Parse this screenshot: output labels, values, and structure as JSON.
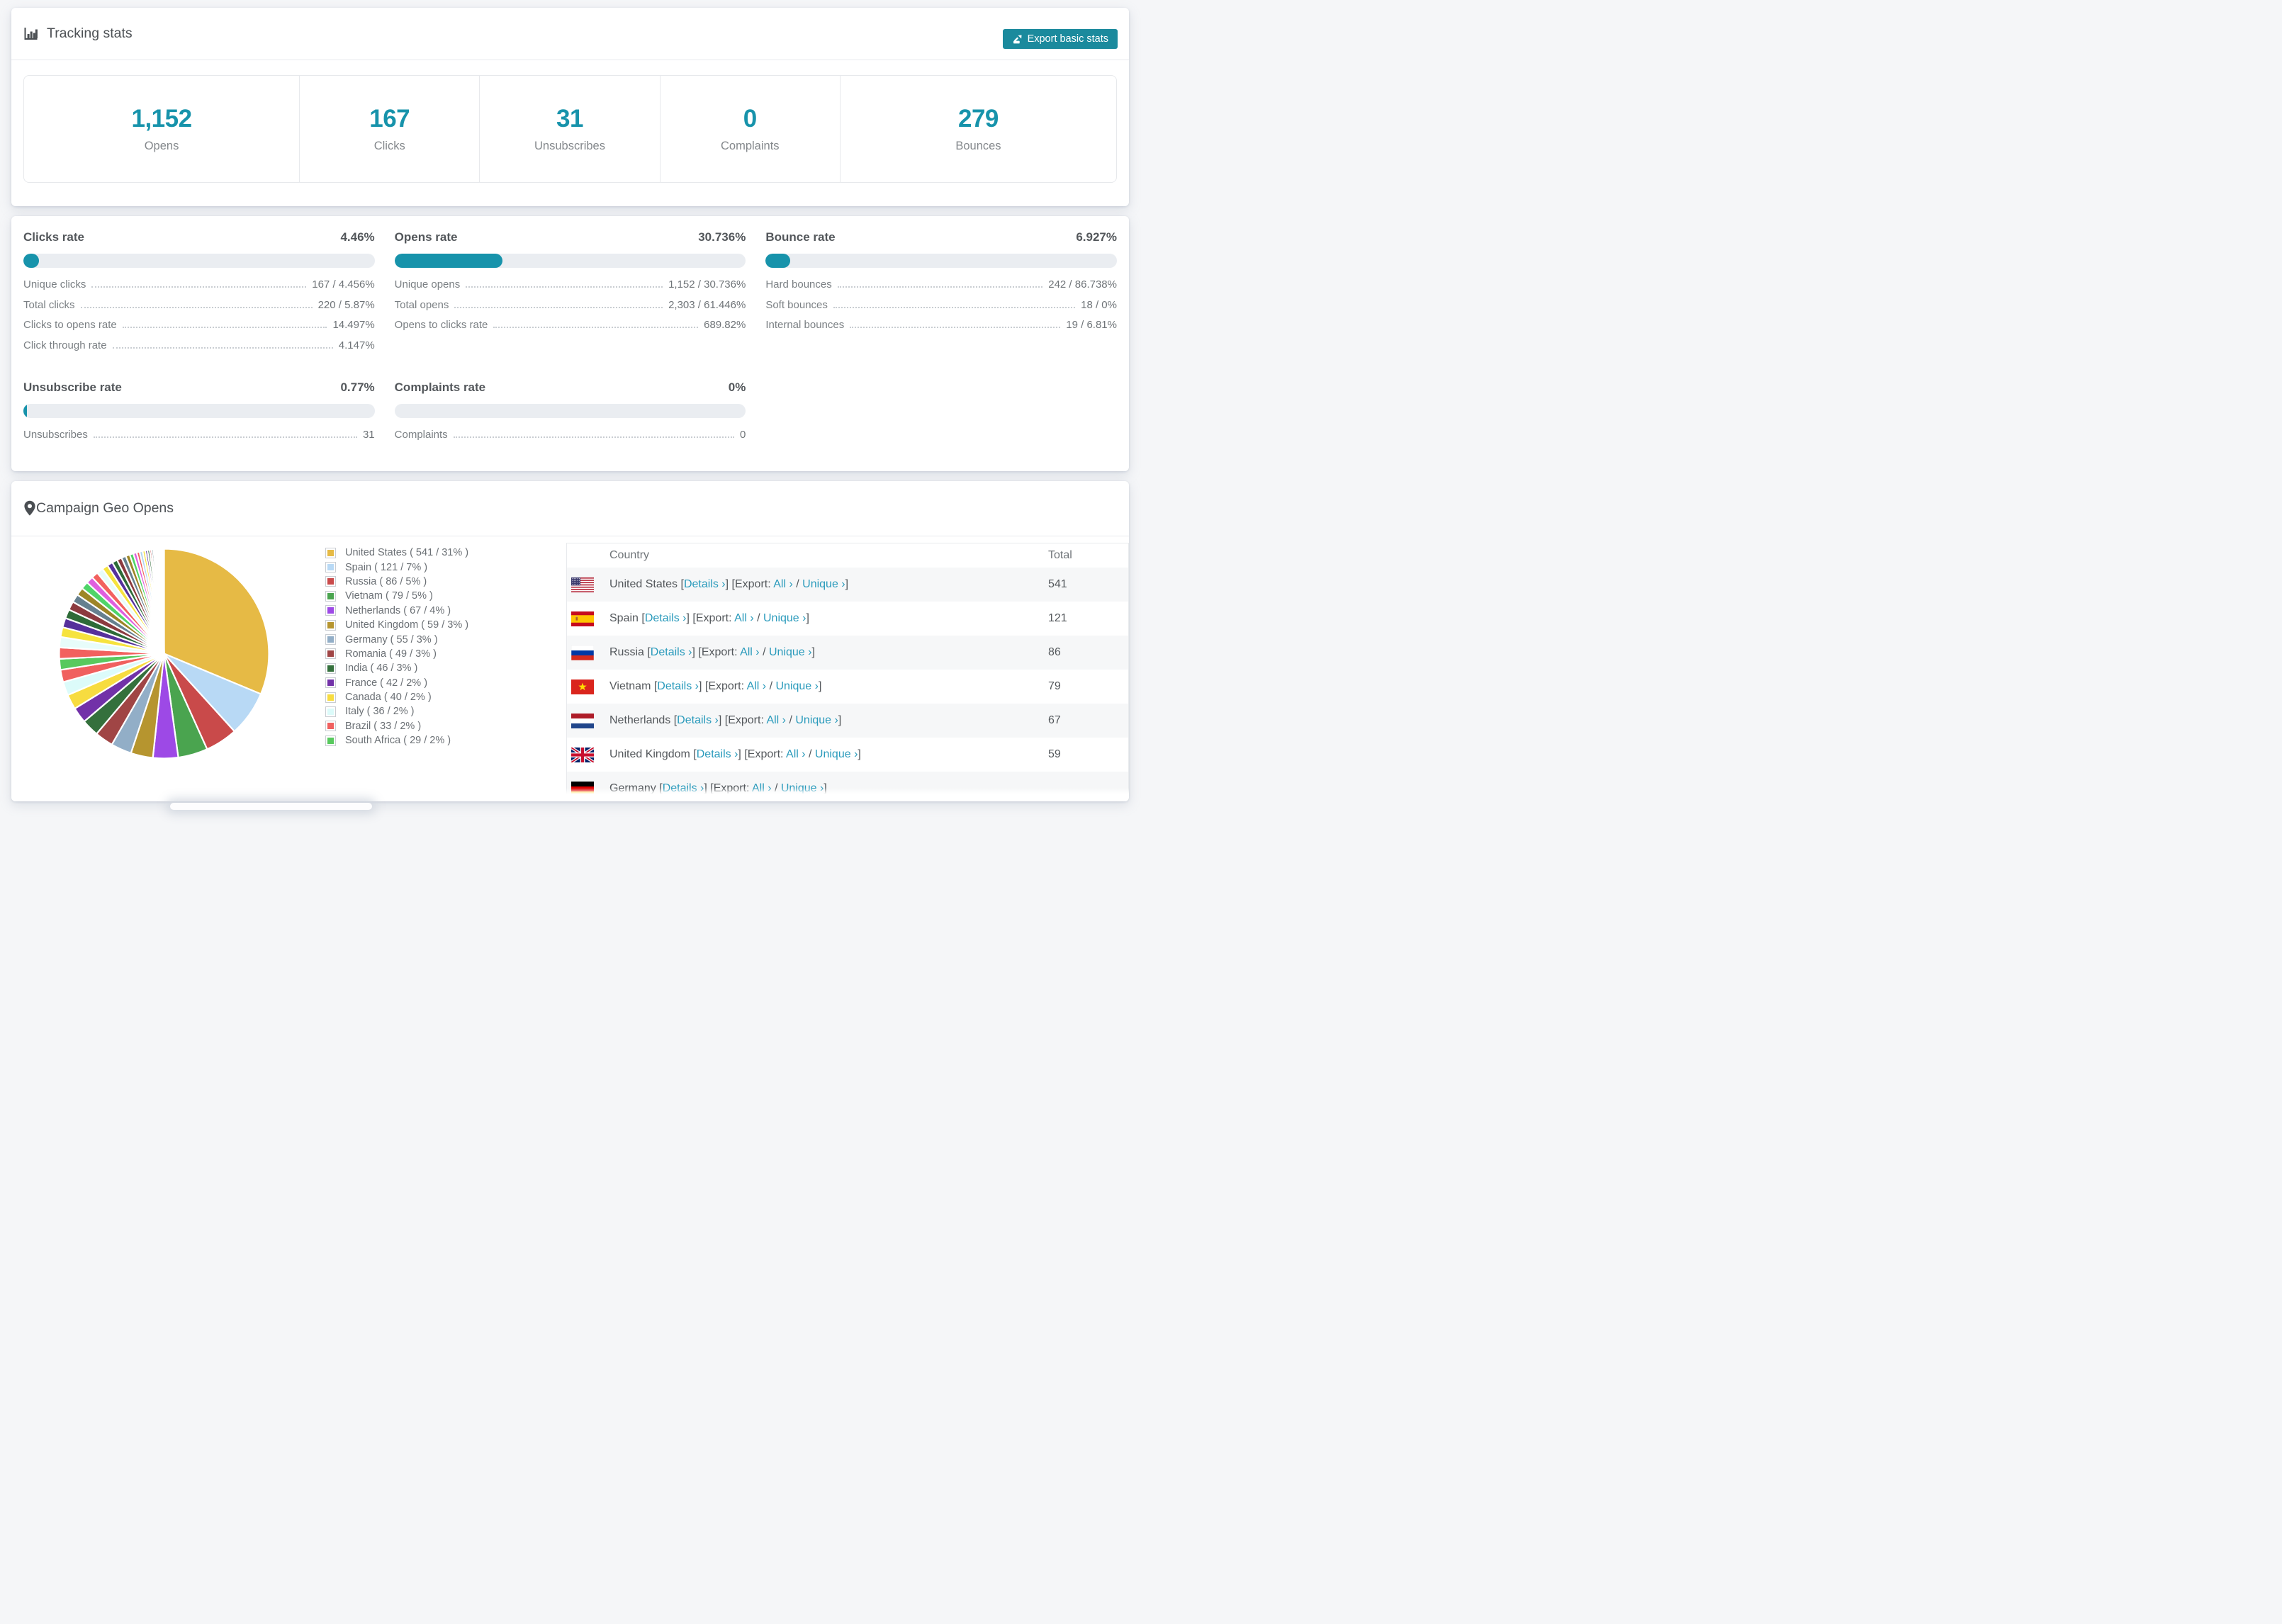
{
  "tracking": {
    "title": "Tracking stats",
    "export_button": "Export basic stats",
    "stats": [
      {
        "value": "1,152",
        "label": "Opens"
      },
      {
        "value": "167",
        "label": "Clicks"
      },
      {
        "value": "31",
        "label": "Unsubscribes"
      },
      {
        "value": "0",
        "label": "Complaints"
      },
      {
        "value": "279",
        "label": "Bounces"
      }
    ]
  },
  "rates": [
    {
      "title": "Clicks rate",
      "value": "4.46%",
      "pct": 4.46,
      "lines": [
        {
          "label": "Unique clicks",
          "value": "167 / 4.456%"
        },
        {
          "label": "Total clicks",
          "value": "220 / 5.87%"
        },
        {
          "label": "Clicks to opens rate",
          "value": "14.497%"
        },
        {
          "label": "Click through rate",
          "value": "4.147%"
        }
      ]
    },
    {
      "title": "Opens rate",
      "value": "30.736%",
      "pct": 30.736,
      "lines": [
        {
          "label": "Unique opens",
          "value": "1,152 / 30.736%"
        },
        {
          "label": "Total opens",
          "value": "2,303 / 61.446%"
        },
        {
          "label": "Opens to clicks rate",
          "value": "689.82%"
        }
      ]
    },
    {
      "title": "Bounce rate",
      "value": "6.927%",
      "pct": 6.927,
      "lines": [
        {
          "label": "Hard bounces",
          "value": "242 / 86.738%"
        },
        {
          "label": "Soft bounces",
          "value": "18 / 0%"
        },
        {
          "label": "Internal bounces",
          "value": "19 / 6.81%"
        }
      ]
    },
    {
      "title": "Unsubscribe rate",
      "value": "0.77%",
      "pct": 0.77,
      "lines": [
        {
          "label": "Unsubscribes",
          "value": "31"
        }
      ]
    },
    {
      "title": "Complaints rate",
      "value": "0%",
      "pct": 0,
      "lines": [
        {
          "label": "Complaints",
          "value": "0"
        }
      ]
    }
  ],
  "geo": {
    "title": "Campaign Geo Opens",
    "legend": [
      {
        "label": "United States ( 541 / 31% )",
        "color": "#e6ba45"
      },
      {
        "label": "Spain ( 121 / 7% )",
        "color": "#b8d9f5"
      },
      {
        "label": "Russia ( 86 / 5% )",
        "color": "#c94a4a"
      },
      {
        "label": "Vietnam ( 79 / 5% )",
        "color": "#4aa44f"
      },
      {
        "label": "Netherlands ( 67 / 4% )",
        "color": "#9d49e6"
      },
      {
        "label": "United Kingdom ( 59 / 3% )",
        "color": "#b6952f"
      },
      {
        "label": "Germany ( 55 / 3% )",
        "color": "#92aec7"
      },
      {
        "label": "Romania ( 49 / 3% )",
        "color": "#a04545"
      },
      {
        "label": "India ( 46 / 3% )",
        "color": "#34703c"
      },
      {
        "label": "France ( 42 / 2% )",
        "color": "#7231a8"
      },
      {
        "label": "Canada ( 40 / 2% )",
        "color": "#f7dc40"
      },
      {
        "label": "Italy ( 36 / 2% )",
        "color": "#dcfbfa"
      },
      {
        "label": "Brazil ( 33 / 2% )",
        "color": "#f0605f"
      },
      {
        "label": "South Africa ( 29 / 2% )",
        "color": "#58c95e"
      }
    ],
    "table": {
      "headers": [
        "Country",
        "Total"
      ],
      "link_labels": {
        "details": "Details ›",
        "export_prefix": "Export:",
        "all": "All ›",
        "unique": "Unique ›"
      },
      "rows": [
        {
          "country": "United States",
          "flag": "us",
          "total": "541"
        },
        {
          "country": "Spain",
          "flag": "es",
          "total": "121"
        },
        {
          "country": "Russia",
          "flag": "ru",
          "total": "86"
        },
        {
          "country": "Vietnam",
          "flag": "vn",
          "total": "79"
        },
        {
          "country": "Netherlands",
          "flag": "nl",
          "total": "67"
        },
        {
          "country": "United Kingdom",
          "flag": "gb",
          "total": "59"
        },
        {
          "country": "Germany",
          "flag": "de",
          "total": ""
        }
      ]
    }
  },
  "chart_data": {
    "type": "pie",
    "title": "Campaign Geo Opens",
    "legend_position": "right",
    "start_angle_deg": -90,
    "direction": "clockwise",
    "slices": [
      {
        "label": "United States",
        "value": 541,
        "pct": 31,
        "color": "#e6ba45"
      },
      {
        "label": "Spain",
        "value": 121,
        "pct": 7,
        "color": "#b8d9f5"
      },
      {
        "label": "Russia",
        "value": 86,
        "pct": 5,
        "color": "#c94a4a"
      },
      {
        "label": "Vietnam",
        "value": 79,
        "pct": 5,
        "color": "#4aa44f"
      },
      {
        "label": "Netherlands",
        "value": 67,
        "pct": 4,
        "color": "#9d49e6"
      },
      {
        "label": "United Kingdom",
        "value": 59,
        "pct": 3,
        "color": "#b6952f"
      },
      {
        "label": "Germany",
        "value": 55,
        "pct": 3,
        "color": "#92aec7"
      },
      {
        "label": "Romania",
        "value": 49,
        "pct": 3,
        "color": "#a04545"
      },
      {
        "label": "India",
        "value": 46,
        "pct": 3,
        "color": "#34703c"
      },
      {
        "label": "France",
        "value": 42,
        "pct": 2,
        "color": "#7231a8"
      },
      {
        "label": "Canada",
        "value": 40,
        "pct": 2,
        "color": "#f7dc40"
      },
      {
        "label": "Italy",
        "value": 36,
        "pct": 2,
        "color": "#dcfbfa"
      },
      {
        "label": "Brazil",
        "value": 33,
        "pct": 2,
        "color": "#f0605f"
      },
      {
        "label": "South Africa",
        "value": 29,
        "pct": 2,
        "color": "#58c95e"
      }
    ],
    "other_slices": [
      {
        "value": 30,
        "color": "#f2615f"
      },
      {
        "value": 28,
        "color": "#e7fcfa"
      },
      {
        "value": 26,
        "color": "#f6e33e"
      },
      {
        "value": 25,
        "color": "#56309b"
      },
      {
        "value": 24,
        "color": "#2e6b38"
      },
      {
        "value": 23,
        "color": "#8c3a3f"
      },
      {
        "value": 22,
        "color": "#66808f"
      },
      {
        "value": 21,
        "color": "#9d8526"
      },
      {
        "value": 20,
        "color": "#4fd469"
      },
      {
        "value": 19,
        "color": "#df5fdf"
      },
      {
        "value": 18,
        "color": "#f2615f"
      },
      {
        "value": 17,
        "color": "#e7fcfa"
      },
      {
        "value": 16,
        "color": "#f6e33e"
      },
      {
        "value": 15,
        "color": "#56309b"
      },
      {
        "value": 14,
        "color": "#2e6b38"
      },
      {
        "value": 13,
        "color": "#8c3a3f"
      },
      {
        "value": 12,
        "color": "#66808f"
      },
      {
        "value": 11,
        "color": "#9d8526"
      },
      {
        "value": 10,
        "color": "#4fd469"
      },
      {
        "value": 9,
        "color": "#df5fdf"
      },
      {
        "value": 8,
        "color": "#f2615f"
      },
      {
        "value": 8,
        "color": "#aed3f0"
      },
      {
        "value": 7,
        "color": "#f6e33e"
      },
      {
        "value": 6,
        "color": "#56309b"
      },
      {
        "value": 6,
        "color": "#2e6b38"
      },
      {
        "value": 5,
        "color": "#c94a4a"
      },
      {
        "value": 5,
        "color": "#66808f"
      },
      {
        "value": 4,
        "color": "#9d8526"
      },
      {
        "value": 4,
        "color": "#4fd469"
      },
      {
        "value": 3,
        "color": "#df5fdf"
      },
      {
        "value": 3,
        "color": "#f2615f"
      },
      {
        "value": 2,
        "color": "#aed3f0"
      },
      {
        "value": 2,
        "color": "#f6e33e"
      },
      {
        "value": 2,
        "color": "#7231a8"
      },
      {
        "value": 1,
        "color": "#2e6b38"
      },
      {
        "value": 1,
        "color": "#c94a4a"
      },
      {
        "value": 1,
        "color": "#66808f"
      },
      {
        "value": 1,
        "color": "#b6952f"
      },
      {
        "value": 1,
        "color": "#4fd469"
      },
      {
        "value": 1,
        "color": "#df5fdf"
      },
      {
        "value": 1,
        "color": "#f2615f"
      },
      {
        "value": 1,
        "color": "#aed3f0"
      }
    ]
  }
}
